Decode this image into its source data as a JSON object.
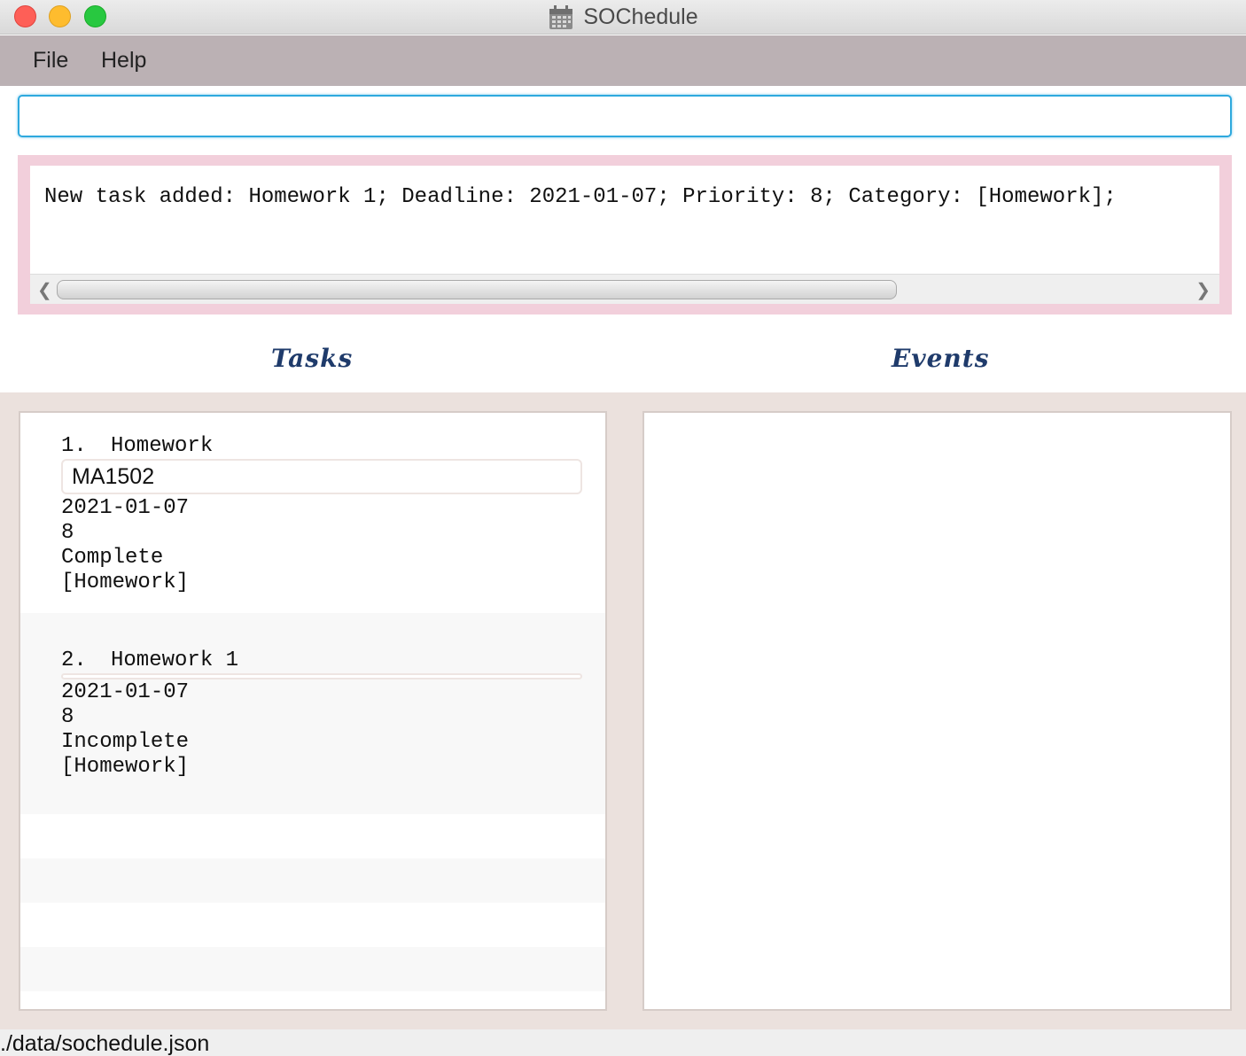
{
  "window": {
    "title": "SOChedule",
    "app_icon": "calendar-icon"
  },
  "menu": {
    "file": "File",
    "help": "Help"
  },
  "command_box": {
    "value": "",
    "placeholder": ""
  },
  "result_display": {
    "text": "New task added: Homework 1; Deadline: 2021-01-07; Priority: 8; Category: [Homework];"
  },
  "sections": {
    "tasks_title": "Tasks",
    "events_title": "Events"
  },
  "tasks": [
    {
      "index": "1.",
      "name": "Homework",
      "description": "MA1502",
      "deadline": "2021-01-07",
      "priority": "8",
      "status": "Complete",
      "category": "[Homework]"
    },
    {
      "index": "2.",
      "name": "Homework 1",
      "description": "",
      "deadline": "2021-01-07",
      "priority": "8",
      "status": "Incomplete",
      "category": "[Homework]"
    }
  ],
  "events": [],
  "status_bar": {
    "save_path": "./data/sochedule.json"
  },
  "colors": {
    "command_border": "#2ea9de",
    "result_border": "#f2cfdb",
    "menu_bg": "#bbb1b4",
    "lists_bg": "#ebe1dd",
    "header_text": "#1f3b6b"
  }
}
